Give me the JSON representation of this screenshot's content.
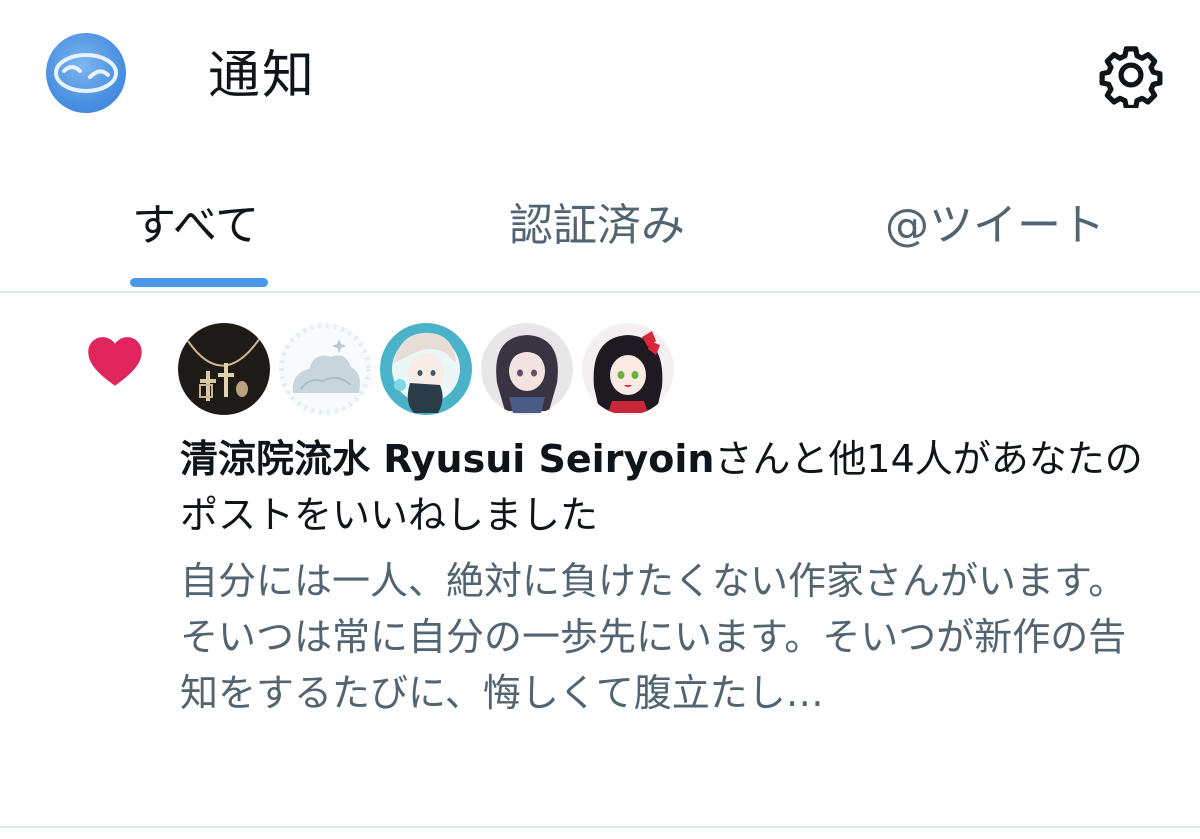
{
  "header": {
    "title": "通知",
    "avatar_icon": "account-avatar",
    "settings_icon": "gear-icon"
  },
  "tabs": [
    {
      "label": "すべて",
      "active": true
    },
    {
      "label": "認証済み",
      "active": false
    },
    {
      "label": "@ツイート",
      "active": false
    }
  ],
  "notification": {
    "type_icon": "heart-icon",
    "type_color": "#e0245e",
    "likers": [
      {
        "avatar": "necklace-avatar"
      },
      {
        "avatar": "cloud-avatar"
      },
      {
        "avatar": "anime-girl-teal-avatar"
      },
      {
        "avatar": "anime-girl-dark-avatar"
      },
      {
        "avatar": "anime-girl-red-ribbon-avatar"
      }
    ],
    "actor_name": "清涼院流水 Ryusui Seiryoin",
    "action_text": "さんと他14人があなたのポストをいいねしました",
    "post_preview": [
      "自分には一人、絶対に負けたくない作家さんがいます。",
      "そいつは常に自分の一歩先にいます。そいつが新作の告知をするたびに、悔しくて腹立たし…"
    ]
  },
  "colors": {
    "accent": "#4a99e9",
    "text_primary": "#0f1419",
    "text_secondary": "#536471",
    "divider": "#e6e9ec"
  }
}
